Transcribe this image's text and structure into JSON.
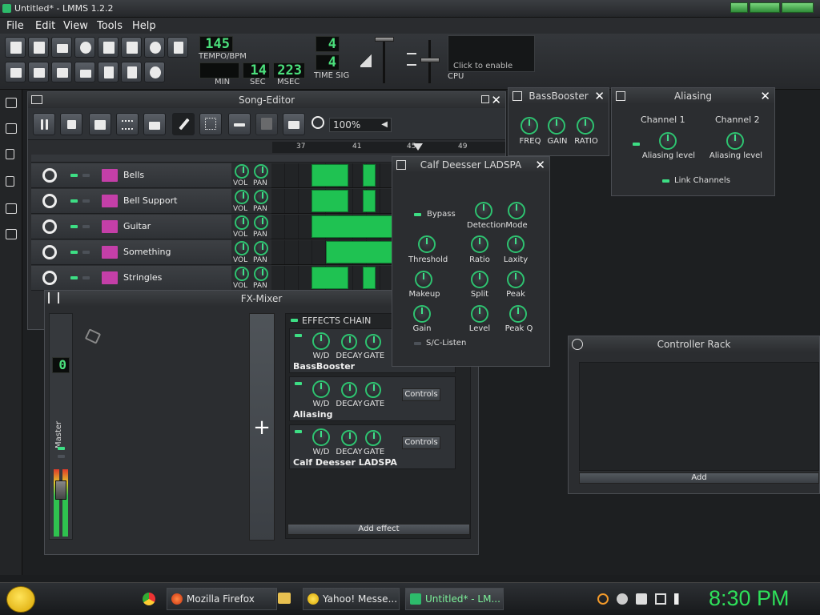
{
  "window": {
    "title": "Untitled* - LMMS 1.2.2"
  },
  "menu": {
    "items": [
      "File",
      "Edit",
      "View",
      "Tools",
      "Help"
    ]
  },
  "toolbar": {
    "tempo": "145",
    "tempo_label": "TEMPO/BPM",
    "time_min": "",
    "time_sec": "14",
    "time_msec": "223",
    "min_label": "MIN",
    "sec_label": "SEC",
    "msec_label": "MSEC",
    "timesig_num": "4",
    "timesig_den": "4",
    "timesig_label": "TIME SIG",
    "cpu_hint": "Click to enable",
    "cpu_label": "CPU"
  },
  "song_editor": {
    "title": "Song-Editor",
    "zoom": "100%",
    "ruler": [
      "37",
      "41",
      "45",
      "49"
    ],
    "vol_label": "VOL",
    "pan_label": "PAN",
    "tracks": [
      "Bells",
      "Bell Support",
      "Guitar",
      "Something",
      "Stringles"
    ]
  },
  "fx_mixer": {
    "title": "FX-Mixer",
    "channel_number": "0",
    "master_label": "Master",
    "add_channel": "+",
    "effects_chain_label": "EFFECTS CHAIN",
    "effects": [
      {
        "name": "BassBooster",
        "wd": "W/D",
        "decay": "DECAY",
        "gate": "GATE",
        "controls": ""
      },
      {
        "name": "Aliasing",
        "wd": "W/D",
        "decay": "DECAY",
        "gate": "GATE",
        "controls": "Controls"
      },
      {
        "name": "Calf Deesser LADSPA",
        "wd": "W/D",
        "decay": "DECAY",
        "gate": "GATE",
        "controls": "Controls"
      }
    ],
    "add_effect": "Add effect"
  },
  "bassbooster": {
    "title": "BassBooster",
    "knobs": [
      "FREQ",
      "GAIN",
      "RATIO"
    ]
  },
  "aliasing": {
    "title": "Aliasing",
    "channel1": "Channel 1",
    "channel2": "Channel 2",
    "aliasing_level": "Aliasing level",
    "link_channels": "Link Channels"
  },
  "deesser": {
    "title": "Calf Deesser LADSPA",
    "bypass": "Bypass",
    "detection": "Detection",
    "mode": "Mode",
    "threshold": "Threshold",
    "ratio": "Ratio",
    "laxity": "Laxity",
    "makeup": "Makeup",
    "split": "Split",
    "peak": "Peak",
    "gain": "Gain",
    "level": "Level",
    "peak_q": "Peak Q",
    "sc_listen": "S/C-Listen"
  },
  "controller_rack": {
    "title": "Controller Rack",
    "add": "Add"
  },
  "taskbar": {
    "items": [
      "Mozilla Firefox",
      "Yahoo! Messe...",
      "Untitled* - LM..."
    ],
    "clock": "8:30 PM"
  },
  "colors": {
    "accent": "#2ec270",
    "lcd": "#4be07c",
    "pattern": "#1fc252",
    "track_icon": "#c43fa8"
  }
}
